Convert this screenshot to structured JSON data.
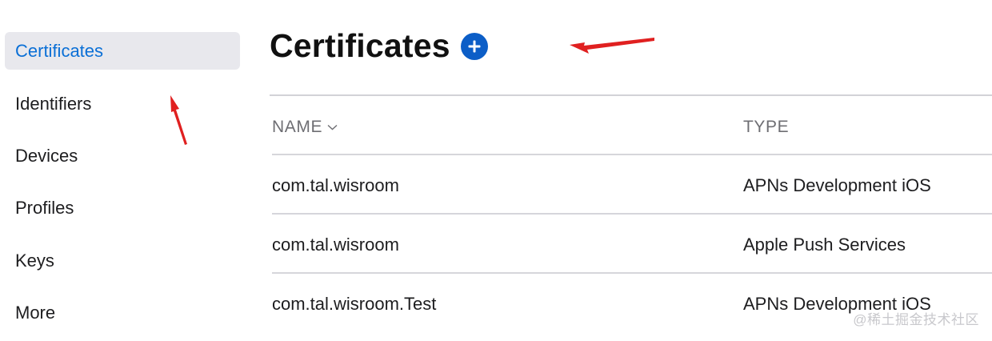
{
  "sidebar": {
    "items": [
      {
        "label": "Certificates",
        "active": true
      },
      {
        "label": "Identifiers",
        "active": false
      },
      {
        "label": "Devices",
        "active": false
      },
      {
        "label": "Profiles",
        "active": false
      },
      {
        "label": "Keys",
        "active": false
      },
      {
        "label": "More",
        "active": false
      }
    ]
  },
  "main": {
    "title": "Certificates",
    "add_icon": "plus-circle-icon",
    "table": {
      "columns": [
        {
          "label": "NAME",
          "sort_icon": "chevron-down-icon"
        },
        {
          "label": "TYPE"
        }
      ],
      "rows": [
        {
          "name": "com.tal.wisroom",
          "type": "APNs Development iOS"
        },
        {
          "name": "com.tal.wisroom",
          "type": "Apple Push Services"
        },
        {
          "name": "com.tal.wisroom.Test",
          "type": "APNs Development iOS"
        }
      ]
    }
  },
  "annotations": {
    "arrow_color": "#e02020",
    "arrow_icon": "red-arrow-icon"
  },
  "watermark": "@稀土掘金技术社区",
  "colors": {
    "accent": "#0a6fd6",
    "active_bg": "#e8e8ed",
    "add_button": "#0c5ec7",
    "divider": "#d6d6db"
  }
}
